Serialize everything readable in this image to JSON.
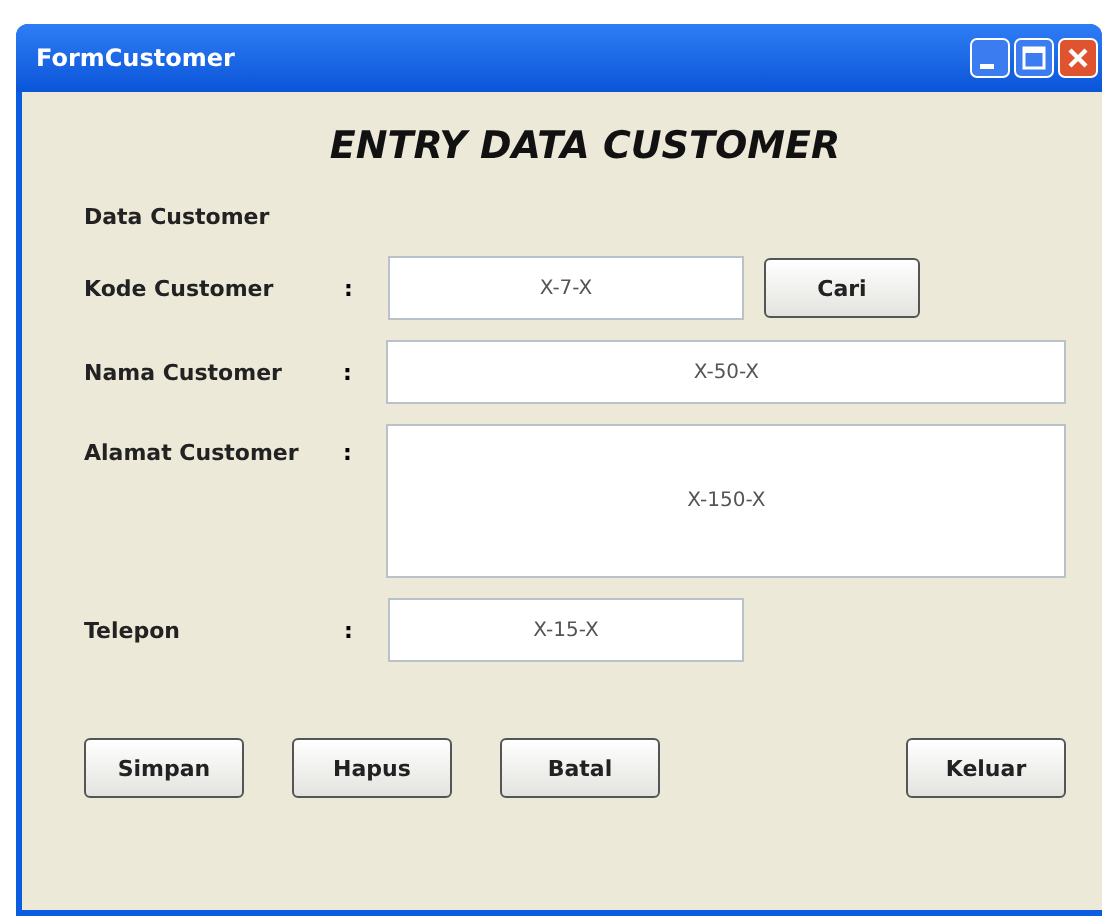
{
  "window": {
    "title": "FormCustomer"
  },
  "heading": "ENTRY DATA CUSTOMER",
  "section_label": "Data Customer",
  "fields": [
    {
      "label": "Kode Customer",
      "separator": ":",
      "value": "X-7-X",
      "kind": "short",
      "button": "Cari"
    },
    {
      "label": "Nama Customer",
      "separator": ":",
      "value": "X-50-X",
      "kind": "wide"
    },
    {
      "label": "Alamat Customer",
      "separator": ":",
      "value": "X-150-X",
      "kind": "area"
    },
    {
      "label": "Telepon",
      "separator": ":",
      "value": "X-15-X",
      "kind": "short"
    }
  ],
  "buttons": [
    "Simpan",
    "Hapus",
    "Batal"
  ],
  "exit_button": "Keluar"
}
